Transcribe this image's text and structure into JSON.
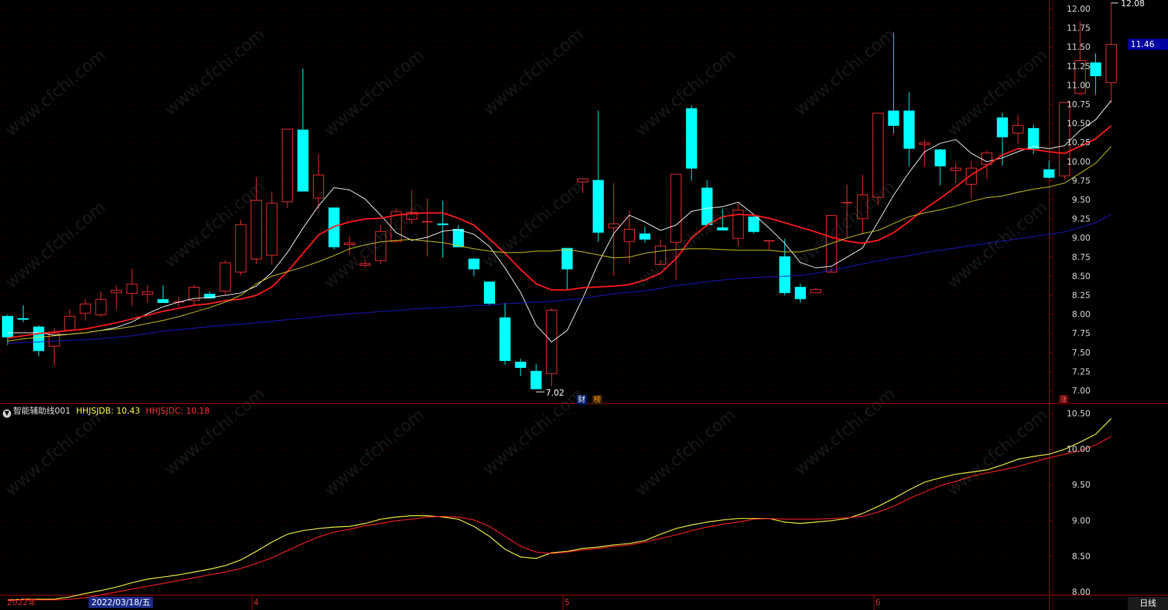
{
  "chart_data": {
    "type": "candlestick",
    "price_axis": {
      "ticks": [
        "12.00",
        "11.75",
        "11.50",
        "11.25",
        "11.00",
        "10.75",
        "10.50",
        "10.25",
        "10.00",
        "9.75",
        "9.50",
        "9.25",
        "9.00",
        "8.75",
        "8.50",
        "8.25",
        "8.00",
        "7.75",
        "7.50",
        "7.25",
        "7.00"
      ],
      "ylim": [
        6.95,
        12.1
      ]
    },
    "indicator_axis": {
      "ticks": [
        "10.50",
        "10.00",
        "9.50",
        "9.00",
        "8.50",
        "8.00"
      ],
      "ylim": [
        7.85,
        10.6
      ]
    },
    "candles": [
      [
        7.98,
        7.7,
        8.0,
        7.6
      ],
      [
        7.95,
        7.93,
        8.12,
        7.9
      ],
      [
        7.84,
        7.52,
        7.86,
        7.45
      ],
      [
        7.58,
        7.76,
        7.82,
        7.33
      ],
      [
        7.79,
        7.98,
        8.07,
        7.78
      ],
      [
        8.01,
        8.14,
        8.2,
        7.92
      ],
      [
        7.99,
        8.2,
        8.3,
        7.97
      ],
      [
        8.28,
        8.32,
        8.38,
        8.06
      ],
      [
        8.27,
        8.4,
        8.6,
        8.11
      ],
      [
        8.26,
        8.3,
        8.38,
        8.15
      ],
      [
        8.2,
        8.15,
        8.38,
        8.15
      ],
      [
        8.17,
        8.17,
        8.23,
        8.1
      ],
      [
        8.18,
        8.36,
        8.39,
        8.12
      ],
      [
        8.27,
        8.21,
        8.3,
        8.22
      ],
      [
        8.3,
        8.68,
        8.71,
        8.26
      ],
      [
        8.55,
        9.18,
        9.24,
        8.51
      ],
      [
        8.72,
        9.5,
        9.8,
        8.66
      ],
      [
        8.77,
        9.46,
        9.61,
        8.65
      ],
      [
        9.47,
        10.43,
        10.43,
        9.39
      ],
      [
        10.42,
        9.61,
        11.22,
        9.61
      ],
      [
        9.52,
        9.83,
        10.1,
        9.38
      ],
      [
        9.4,
        8.88,
        9.4,
        8.85
      ],
      [
        8.91,
        8.94,
        9.02,
        8.78
      ],
      [
        8.64,
        8.67,
        8.72,
        8.61
      ],
      [
        8.7,
        9.09,
        9.17,
        8.66
      ],
      [
        8.95,
        9.35,
        9.39,
        8.94
      ],
      [
        9.24,
        9.34,
        9.63,
        9.18
      ],
      [
        9.21,
        9.22,
        9.52,
        8.76
      ],
      [
        9.19,
        9.17,
        9.49,
        8.74
      ],
      [
        9.12,
        8.88,
        9.17,
        8.9
      ],
      [
        8.73,
        8.59,
        8.74,
        8.5
      ],
      [
        8.43,
        8.14,
        8.43,
        8.12
      ],
      [
        7.96,
        7.39,
        8.15,
        7.34
      ],
      [
        7.38,
        7.3,
        7.42,
        7.19
      ],
      [
        7.26,
        7.02,
        7.35,
        7.02
      ],
      [
        7.22,
        8.06,
        8.08,
        7.06
      ],
      [
        8.87,
        8.59,
        8.87,
        8.33
      ],
      [
        9.73,
        9.78,
        9.78,
        9.59
      ],
      [
        9.76,
        9.07,
        10.67,
        8.95
      ],
      [
        9.13,
        9.19,
        9.72,
        8.51
      ],
      [
        8.95,
        9.12,
        9.36,
        8.66
      ],
      [
        9.06,
        8.98,
        9.15,
        8.94
      ],
      [
        8.65,
        8.9,
        8.98,
        8.71
      ],
      [
        8.94,
        9.84,
        9.84,
        8.45
      ],
      [
        10.7,
        9.91,
        10.74,
        9.75
      ],
      [
        9.66,
        9.17,
        9.76,
        9.24
      ],
      [
        9.14,
        9.1,
        9.38,
        9.1
      ],
      [
        8.99,
        9.37,
        9.45,
        8.89
      ],
      [
        9.28,
        9.08,
        9.31,
        9.06
      ],
      [
        8.96,
        8.97,
        8.97,
        8.85
      ],
      [
        8.76,
        8.28,
        8.99,
        8.25
      ],
      [
        8.36,
        8.2,
        8.4,
        8.15
      ],
      [
        8.28,
        8.33,
        8.35,
        8.29
      ],
      [
        8.55,
        9.3,
        9.3,
        8.6
      ],
      [
        9.46,
        9.47,
        9.7,
        9.0
      ],
      [
        9.25,
        9.57,
        9.83,
        9.05
      ],
      [
        9.53,
        10.64,
        10.64,
        9.43
      ],
      [
        10.67,
        10.47,
        11.69,
        10.37
      ],
      [
        10.67,
        10.17,
        10.91,
        9.94
      ],
      [
        10.22,
        10.25,
        10.29,
        9.94
      ],
      [
        10.16,
        9.94,
        10.17,
        9.69
      ],
      [
        9.88,
        9.92,
        9.98,
        9.72
      ],
      [
        9.7,
        9.92,
        10.01,
        9.52
      ],
      [
        9.96,
        10.12,
        10.15,
        9.77
      ],
      [
        10.58,
        10.32,
        10.64,
        9.95
      ],
      [
        10.37,
        10.48,
        10.61,
        10.23
      ],
      [
        10.44,
        10.17,
        10.49,
        10.1
      ],
      [
        9.9,
        9.79,
        10.02,
        9.78
      ],
      [
        9.81,
        10.78,
        10.78,
        9.77
      ],
      [
        10.89,
        11.33,
        11.84,
        10.87
      ],
      [
        11.3,
        11.12,
        11.42,
        10.88
      ],
      [
        11.03,
        11.54,
        12.08,
        10.77
      ]
    ],
    "ma_series": [
      {
        "color": "#ffffff",
        "values": [
          7.76,
          7.76,
          7.76,
          7.73,
          7.74,
          7.76,
          7.79,
          7.83,
          7.9,
          8.01,
          8.1,
          8.16,
          8.21,
          8.22,
          8.25,
          8.28,
          8.37,
          8.55,
          8.81,
          9.13,
          9.42,
          9.66,
          9.63,
          9.51,
          9.3,
          9.07,
          8.97,
          9.01,
          9.09,
          9.11,
          9.05,
          8.89,
          8.61,
          8.29,
          7.86,
          7.64,
          7.79,
          8.21,
          8.67,
          9.06,
          9.3,
          9.21,
          9.1,
          9.17,
          9.35,
          9.39,
          9.41,
          9.47,
          9.31,
          9.13,
          8.93,
          8.68,
          8.61,
          8.63,
          8.75,
          8.87,
          9.21,
          9.56,
          9.86,
          10.13,
          10.24,
          10.29,
          10.11,
          10.0,
          10.05,
          10.13,
          10.2,
          10.17,
          10.21,
          10.41,
          10.55,
          10.8
        ]
      },
      {
        "color": "#ff1a1a",
        "values": [
          7.69,
          7.72,
          7.75,
          7.77,
          7.79,
          7.81,
          7.85,
          7.89,
          7.94,
          7.99,
          8.04,
          8.08,
          8.12,
          8.14,
          8.18,
          8.2,
          8.25,
          8.36,
          8.56,
          8.8,
          9.04,
          9.15,
          9.21,
          9.25,
          9.26,
          9.3,
          9.32,
          9.33,
          9.33,
          9.26,
          9.17,
          8.99,
          8.8,
          8.59,
          8.4,
          8.32,
          8.32,
          8.35,
          8.36,
          8.37,
          8.39,
          8.45,
          8.54,
          8.73,
          9.0,
          9.17,
          9.28,
          9.31,
          9.3,
          9.26,
          9.2,
          9.14,
          9.08,
          9.01,
          8.96,
          8.93,
          8.97,
          9.07,
          9.22,
          9.38,
          9.52,
          9.67,
          9.83,
          9.95,
          10.09,
          10.17,
          10.16,
          10.13,
          10.11,
          10.2,
          10.3,
          10.47
        ]
      },
      {
        "color": "#d8d020",
        "values": [
          7.65,
          7.68,
          7.7,
          7.72,
          7.74,
          7.76,
          7.79,
          7.81,
          7.84,
          7.88,
          7.92,
          7.97,
          8.03,
          8.09,
          8.16,
          8.25,
          8.4,
          8.5,
          8.56,
          8.62,
          8.69,
          8.77,
          8.86,
          8.91,
          8.95,
          8.97,
          8.98,
          8.96,
          8.94,
          8.9,
          8.86,
          8.83,
          8.81,
          8.81,
          8.83,
          8.83,
          8.85,
          8.82,
          8.78,
          8.74,
          8.75,
          8.8,
          8.83,
          8.85,
          8.86,
          8.86,
          8.85,
          8.84,
          8.84,
          8.84,
          8.82,
          8.82,
          8.86,
          8.93,
          9.0,
          9.06,
          9.1,
          9.19,
          9.28,
          9.33,
          9.37,
          9.42,
          9.48,
          9.53,
          9.55,
          9.6,
          9.64,
          9.67,
          9.72,
          9.85,
          9.98,
          10.2
        ]
      },
      {
        "color": "#1a1acc",
        "values": [
          7.62,
          7.63,
          7.64,
          7.65,
          7.66,
          7.67,
          7.68,
          7.7,
          7.72,
          7.75,
          7.78,
          7.8,
          7.82,
          7.84,
          7.86,
          7.87,
          7.89,
          7.91,
          7.93,
          7.95,
          7.97,
          7.99,
          8.01,
          8.02,
          8.04,
          8.05,
          8.07,
          8.08,
          8.09,
          8.1,
          8.12,
          8.12,
          8.14,
          8.15,
          8.16,
          8.17,
          8.19,
          8.21,
          8.24,
          8.27,
          8.29,
          8.31,
          8.34,
          8.38,
          8.4,
          8.43,
          8.45,
          8.47,
          8.48,
          8.49,
          8.5,
          8.51,
          8.54,
          8.58,
          8.62,
          8.66,
          8.7,
          8.74,
          8.77,
          8.81,
          8.84,
          8.87,
          8.9,
          8.93,
          8.96,
          8.99,
          9.02,
          9.05,
          9.08,
          9.14,
          9.2,
          9.31
        ]
      }
    ],
    "high_marker": "12.08",
    "low_marker": "7.02",
    "current_price": "11.46",
    "indicator": {
      "name": "智能辅助线001",
      "series": [
        {
          "name": "HHJSJDB",
          "value": "10.43",
          "color": "#ffff40",
          "values": [
            7.89,
            7.9,
            7.9,
            7.9,
            7.93,
            7.98,
            8.02,
            8.07,
            8.13,
            8.18,
            8.21,
            8.24,
            8.28,
            8.32,
            8.37,
            8.45,
            8.57,
            8.7,
            8.81,
            8.86,
            8.89,
            8.91,
            8.92,
            8.96,
            9.02,
            9.05,
            9.07,
            9.07,
            9.05,
            9.02,
            8.92,
            8.78,
            8.6,
            8.49,
            8.47,
            8.55,
            8.57,
            8.61,
            8.63,
            8.66,
            8.68,
            8.72,
            8.81,
            8.89,
            8.94,
            8.98,
            9.01,
            9.03,
            9.03,
            9.03,
            8.98,
            8.96,
            8.98,
            9.0,
            9.03,
            9.1,
            9.2,
            9.31,
            9.43,
            9.54,
            9.6,
            9.65,
            9.68,
            9.71,
            9.78,
            9.86,
            9.9,
            9.93,
            10.0,
            10.1,
            10.21,
            10.43
          ]
        },
        {
          "name": "HHJSJDC",
          "value": "10.18",
          "color": "#ff2020",
          "values": [
            7.88,
            7.89,
            7.89,
            7.89,
            7.9,
            7.92,
            7.96,
            8.0,
            8.04,
            8.08,
            8.12,
            8.16,
            8.2,
            8.24,
            8.28,
            8.33,
            8.4,
            8.48,
            8.58,
            8.68,
            8.77,
            8.84,
            8.88,
            8.93,
            8.96,
            9.0,
            9.02,
            9.05,
            9.06,
            9.05,
            9.01,
            8.92,
            8.78,
            8.64,
            8.56,
            8.54,
            8.56,
            8.59,
            8.61,
            8.64,
            8.66,
            8.7,
            8.75,
            8.8,
            8.86,
            8.91,
            8.95,
            8.98,
            9.02,
            9.03,
            9.02,
            9.02,
            9.02,
            9.03,
            9.04,
            9.06,
            9.12,
            9.2,
            9.31,
            9.4,
            9.49,
            9.55,
            9.62,
            9.67,
            9.71,
            9.76,
            9.82,
            9.88,
            9.93,
            9.98,
            10.06,
            10.18
          ]
        }
      ]
    },
    "events": [
      {
        "label": "财",
        "index": 37,
        "style": "b"
      },
      {
        "label": "榜",
        "index": 38,
        "style": "o"
      },
      {
        "label": "涨",
        "index": 68,
        "style": "r"
      }
    ],
    "x_axis": {
      "labels": [
        {
          "text": "2022年",
          "index": 0
        },
        {
          "text": "4",
          "index": 16
        },
        {
          "text": "5",
          "index": 36
        },
        {
          "text": "6",
          "index": 56
        }
      ],
      "cursor_date": "2022/03/18/五"
    },
    "cycle": "日线",
    "colors": {
      "up": "#ff3030",
      "down": "#00ffff",
      "background": "#000000",
      "border": "#aa0000"
    },
    "watermark": "www.cfchi.com"
  }
}
